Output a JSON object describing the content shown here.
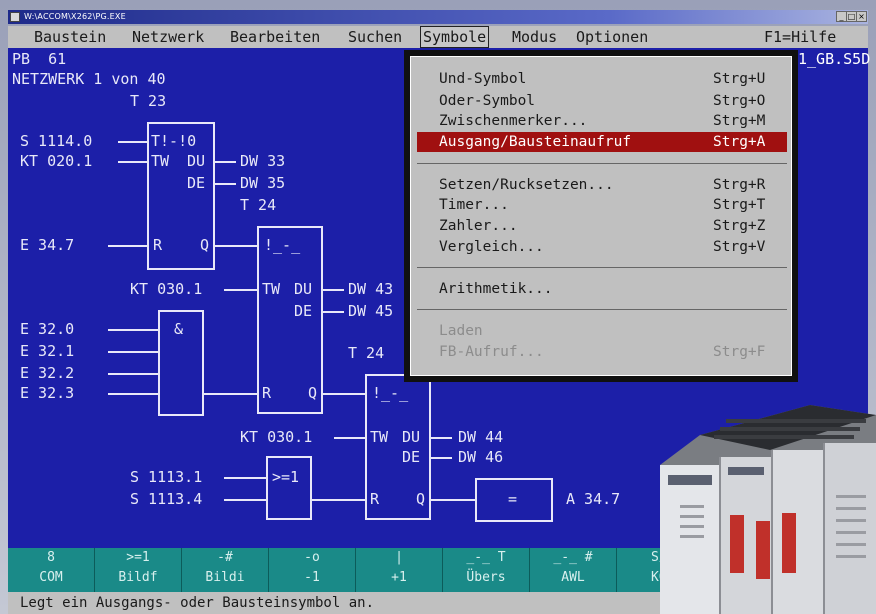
{
  "window": {
    "title": "W:\\ACCOM\\X262\\PG.EXE",
    "controls": [
      "_",
      "□",
      "×"
    ]
  },
  "menubar": {
    "items": [
      "Baustein",
      "Netzwerk",
      "Bearbeiten",
      "Suchen",
      "Symbole",
      "Modus",
      "Optionen"
    ],
    "help": "F1=Hilfe"
  },
  "header": {
    "block": "PB  61",
    "network": "NETZWERK 1 von 40",
    "partial_right": "1_GB.S5D"
  },
  "ladder": {
    "t23": "T 23",
    "s1114": "S 1114.0",
    "kt020": "KT 020.1",
    "t_box": "T!-!0",
    "tw": "TW",
    "du": "DU",
    "de": "DE",
    "dw33": "DW 33",
    "dw35": "DW 35",
    "t24a": "T 24",
    "e347": "E 34.7",
    "r": "R",
    "q": "Q",
    "timer2": "!_-_",
    "kt030a": "KT 030.1",
    "dw43": "DW 43",
    "dw45": "DW 45",
    "and": "&",
    "e320": "E 32.0",
    "e321": "E 32.1",
    "e322": "E 32.2",
    "e323": "E 32.3",
    "t24b": "T 24",
    "kt030b": "KT 030.1",
    "dw44": "DW 44",
    "dw46": "DW 46",
    "s11131": "S 1113.1",
    "s11134": "S 1113.4",
    "ge1": ">=1",
    "assign": "=",
    "a347": "A 34.7"
  },
  "menu": {
    "groups": [
      [
        {
          "label": "Und-Symbol",
          "shortcut": "Strg+U"
        },
        {
          "label": "Oder-Symbol",
          "shortcut": "Strg+O"
        },
        {
          "label": "Zwischenmerker...",
          "shortcut": "Strg+M"
        },
        {
          "label": "Ausgang/Bausteinaufruf",
          "shortcut": "Strg+A"
        }
      ],
      [
        {
          "label": "Setzen/Rucksetzen...",
          "shortcut": "Strg+R"
        },
        {
          "label": "Timer...",
          "shortcut": "Strg+T"
        },
        {
          "label": "Zahler...",
          "shortcut": "Strg+Z"
        },
        {
          "label": "Vergleich...",
          "shortcut": "Strg+V"
        }
      ],
      [
        {
          "label": "Arithmetik...",
          "shortcut": ""
        }
      ],
      [
        {
          "label": "Laden",
          "shortcut": ""
        },
        {
          "label": "FB-Aufruf...",
          "shortcut": "Strg+F"
        }
      ]
    ]
  },
  "fkeys": [
    {
      "top": "8",
      "bottom": "COM"
    },
    {
      "top": ">=1",
      "bottom": "Bildf"
    },
    {
      "top": "-#",
      "bottom": "Bildi"
    },
    {
      "top": "-o",
      "bottom": "-1"
    },
    {
      "top": "|",
      "bottom": "+1"
    },
    {
      "top": "_-_ T",
      "bottom": "Übers"
    },
    {
      "top": "_-_ #",
      "bottom": "AWL"
    },
    {
      "top": "S/",
      "bottom": "KO"
    }
  ],
  "status": "Legt ein Ausgangs- oder Bausteinsymbol an.",
  "colors": {
    "screen": "#1c1fa8",
    "menu_bg": "#c0c0c0",
    "selected": "#a01010",
    "fkeys": "#1a8a88",
    "hotkey": "#1a1acc"
  }
}
